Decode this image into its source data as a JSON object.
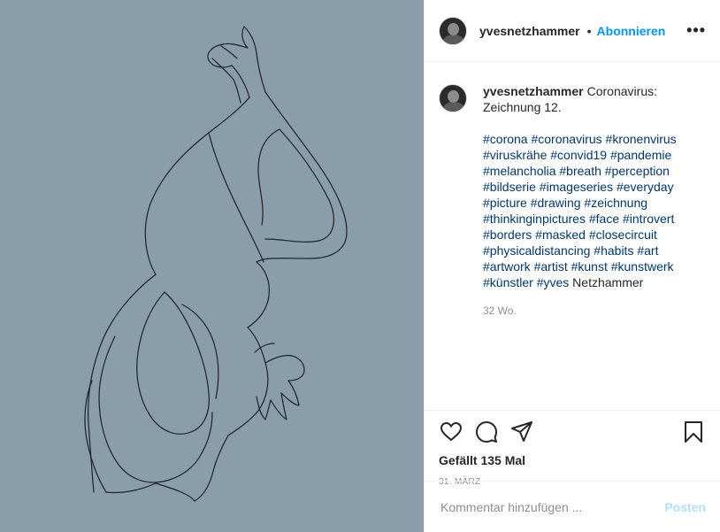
{
  "post": {
    "username": "yvesnetzhammer",
    "separator": "•",
    "follow_label": "Abonnieren",
    "more_label": "•••",
    "caption": {
      "username": "yvesnetzhammer",
      "text": "Coronavirus: Zeichnung 12.",
      "tags_line": [
        [
          "#corona",
          "#coronavirus",
          "#kronenvirus"
        ],
        [
          "#viruskrähe",
          "#convid19",
          "#pandemie"
        ],
        [
          "#melancholia",
          "#breath",
          "#perception"
        ],
        [
          "#bildserie",
          "#imageseries",
          "#everyday"
        ],
        [
          "#picture",
          "#drawing",
          "#zeichnung"
        ],
        [
          "#thinkinginpictures",
          "#face",
          "#introvert"
        ],
        [
          "#borders",
          "#masked",
          "#closecircuit"
        ],
        [
          "#physicaldistancing",
          "#habits",
          "#art"
        ],
        [
          "#artwork",
          "#artist",
          "#kunst",
          "#kunstwerk"
        ],
        [
          "#künstler",
          "#yves"
        ]
      ],
      "trailing_word": "Netzhammer",
      "age": "32 Wo."
    },
    "likes_text": "Gefällt 135 Mal",
    "date_text": "31. MÄRZ",
    "comment_placeholder": "Kommentar hinzufügen ...",
    "post_button": "Posten",
    "colors": {
      "media_bg": "#899dab",
      "link": "#0095f6",
      "hashtag": "#00376b",
      "muted": "#8e8e8e",
      "post_disabled": "#b2dffc"
    },
    "icons": {
      "like": "heart-icon",
      "comment": "comment-icon",
      "share": "paper-plane-icon",
      "save": "bookmark-icon"
    }
  }
}
